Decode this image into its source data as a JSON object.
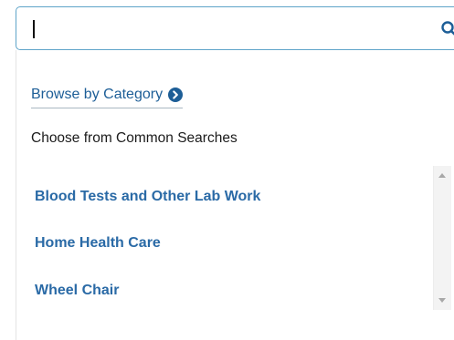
{
  "search": {
    "value": "",
    "placeholder": ""
  },
  "icons": {
    "search": "search-icon",
    "browse_chevron": "chevron-circle-right-icon"
  },
  "browse": {
    "label": "Browse by Category"
  },
  "common_searches": {
    "heading": "Choose from Common Searches",
    "items": [
      {
        "label": "Blood Tests and Other Lab Work"
      },
      {
        "label": "Home Health Care"
      },
      {
        "label": "Wheel Chair"
      }
    ]
  },
  "colors": {
    "accent": "#1d5e97",
    "link": "#2a6aa6",
    "border": "#5fa4c9",
    "text": "#1b1b1b"
  }
}
